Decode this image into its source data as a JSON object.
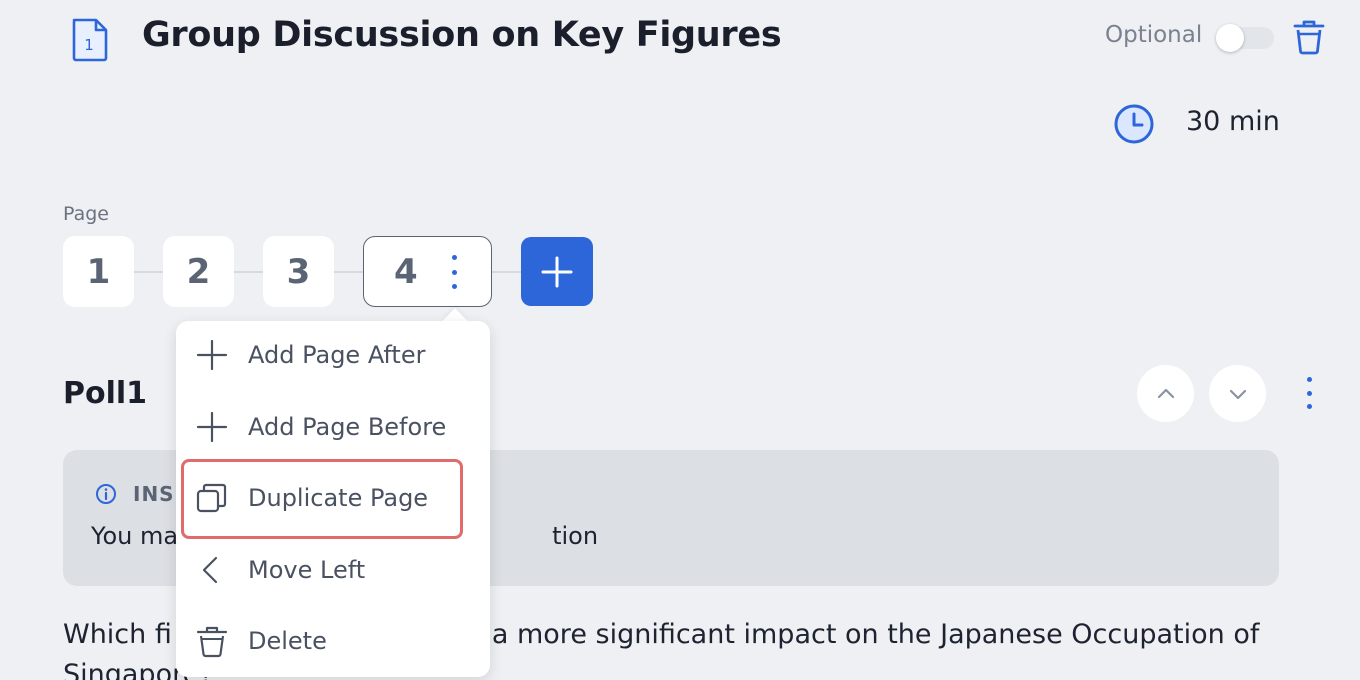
{
  "header": {
    "title": "Group Discussion on Key Figures",
    "doc_icon_number": "1",
    "optional_label": "Optional",
    "optional_on": false,
    "duration": "30 min"
  },
  "pages": {
    "label": "Page",
    "tabs": [
      {
        "label": "1"
      },
      {
        "label": "2"
      },
      {
        "label": "3"
      },
      {
        "label": "4",
        "active": true
      }
    ]
  },
  "page_menu": {
    "items": [
      {
        "label": "Add Page After",
        "icon": "plus-icon"
      },
      {
        "label": "Add Page Before",
        "icon": "plus-icon"
      },
      {
        "label": "Duplicate Page",
        "icon": "duplicate-icon",
        "highlighted": true
      },
      {
        "label": "Move Left",
        "icon": "chevron-left-icon"
      },
      {
        "label": "Delete",
        "icon": "trash-icon"
      }
    ]
  },
  "poll": {
    "title": "Poll1",
    "instruction_label": "INS",
    "instruction_text_start": "You ma",
    "instruction_text_end": "tion",
    "question_start": "Which fi",
    "question_end": "a more significant impact on the Japanese Occupation of",
    "question_line2": "Singapore?"
  },
  "colors": {
    "accent": "#2d66d8",
    "background": "#eef0f3",
    "highlight_border": "#e06b6b"
  }
}
